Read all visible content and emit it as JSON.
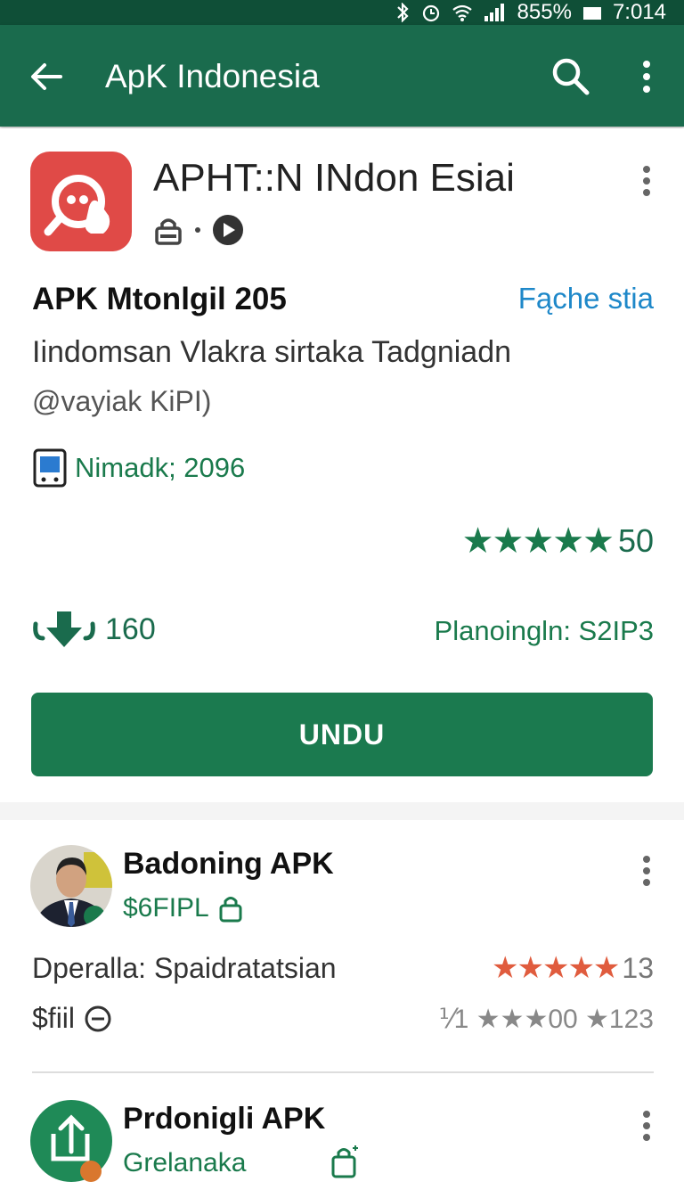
{
  "status_bar": {
    "battery": "855%",
    "time": "7:014"
  },
  "app_bar": {
    "title": "ApK Indonesia"
  },
  "app": {
    "name": "APHT::N INdon Esiai",
    "headline": "APK Mtonlgil 205",
    "headline_link": "Fąche stia",
    "description": "Iindomsan Vlakra sirtaka Tadgniadn",
    "developer": "@vayiak KiPI)",
    "version": "Nimadk; 2096",
    "rating_value": "50",
    "downloads": "160",
    "platform": "Planoingln: S2IP3",
    "download_button": "UNDU"
  },
  "reviews": [
    {
      "name": "Badoning APK",
      "sub": "$6FIPL",
      "detail": "Dperalla: Spaidratatsian",
      "rating_text": "13",
      "price": "$fiil",
      "mini_rating": "⅟1 ★★★00 ★123"
    },
    {
      "name": "Prdonigli APK",
      "sub": "Grelanaka"
    }
  ],
  "colors": {
    "primary": "#1a6b4d",
    "accent_link": "#1e88c9",
    "app_icon": "#e04a47",
    "review_star": "#e05c3e"
  }
}
